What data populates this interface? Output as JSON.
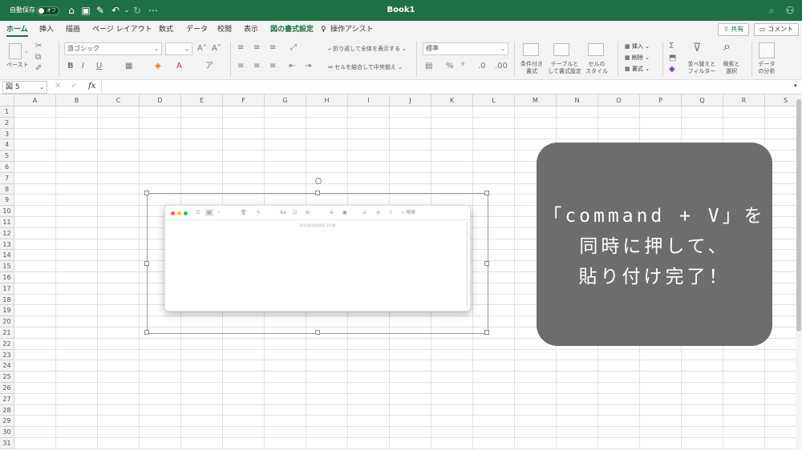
{
  "titlebar": {
    "autosave_label": "自動保存",
    "autosave_state": "オフ",
    "doc_title": "Book1",
    "bg_color": "#1e7145"
  },
  "tabs": [
    "ホーム",
    "挿入",
    "描画",
    "ページ レイアウト",
    "数式",
    "データ",
    "校閲",
    "表示",
    "図の書式設定"
  ],
  "assist_label": "操作アシスト",
  "share_label": "共有",
  "comment_label": "コメント",
  "ribbon": {
    "paste_label": "ペースト",
    "font_name": "游ゴシック",
    "font_size": "",
    "wrap_text": "折り返して全体を表示する",
    "merge_center": "セルを結合して中央揃え",
    "number_format": "標準",
    "cond_format": [
      "条件付き",
      "書式"
    ],
    "table_format": [
      "テーブルと",
      "して書式設定"
    ],
    "cell_style": [
      "セルの",
      "スタイル"
    ],
    "insert": "挿入",
    "delete": "削除",
    "format": "書式",
    "sort_filter": [
      "並べ替えと",
      "フィルター"
    ],
    "find_select": [
      "検索と",
      "選択"
    ],
    "data_analysis": [
      "データ",
      "の分析"
    ]
  },
  "formula_bar": {
    "name_box": "図 5",
    "fx": "fx",
    "value": ""
  },
  "columns": [
    "A",
    "B",
    "C",
    "D",
    "E",
    "F",
    "G",
    "H",
    "I",
    "J",
    "K",
    "L",
    "M",
    "N",
    "O",
    "P",
    "Q",
    "R",
    "S"
  ],
  "rows": [
    "1",
    "2",
    "3",
    "4",
    "5",
    "6",
    "7",
    "8",
    "9",
    "10",
    "11",
    "12",
    "13",
    "14",
    "15",
    "16",
    "17",
    "18",
    "19",
    "20",
    "21",
    "22",
    "23",
    "24",
    "25",
    "26",
    "27",
    "28",
    "29",
    "30",
    "31"
  ],
  "pasted_window": {
    "date_text": "2022年10月08日 15:00",
    "search_placeholder": "検索"
  },
  "callout": {
    "lines": [
      "「command + V」を",
      "同時に押して、",
      "貼り付け完了！"
    ],
    "bg_color": "#6d6d6d"
  }
}
